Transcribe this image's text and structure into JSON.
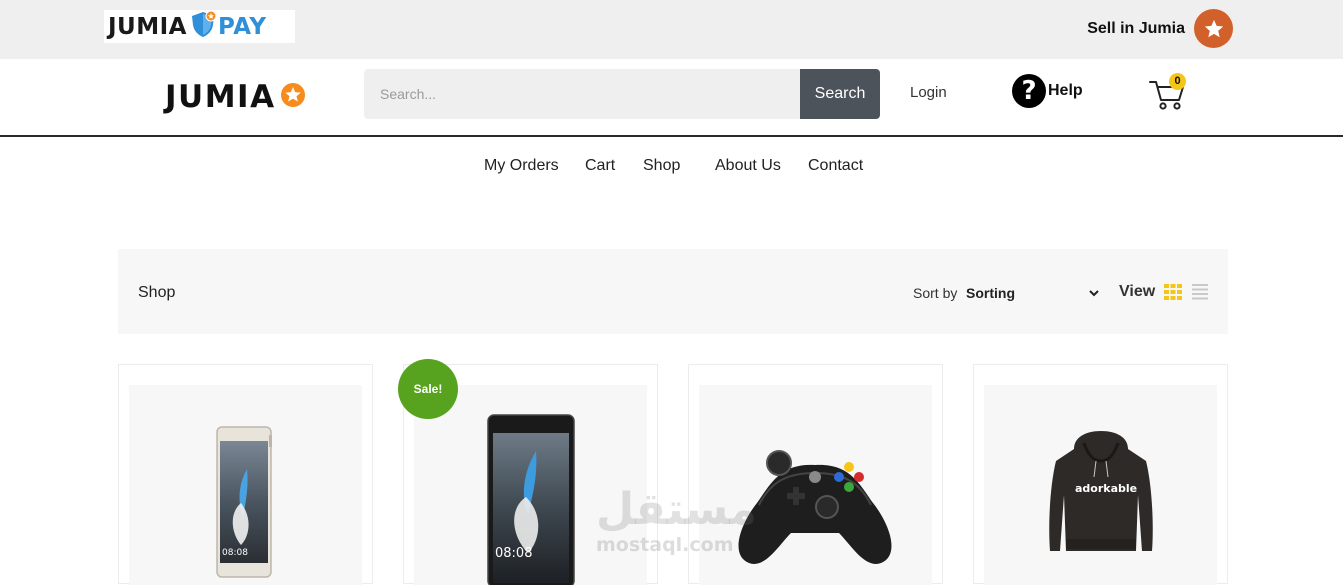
{
  "topbar": {
    "pay_logo_left": "JUMIA",
    "pay_logo_right": "PAY",
    "sell_label": "Sell in Jumia"
  },
  "header": {
    "logo_text": "JUMIA",
    "search_placeholder": "Search...",
    "search_button": "Search",
    "login_label": "Login",
    "help_label": "Help",
    "cart_count": "0"
  },
  "nav": {
    "items": [
      {
        "label": "My Orders"
      },
      {
        "label": "Cart"
      },
      {
        "label": "Shop"
      },
      {
        "label": "About Us"
      },
      {
        "label": "Contact"
      }
    ]
  },
  "shopbar": {
    "title": "Shop",
    "sort_label": "Sort by",
    "sort_value": "Sorting",
    "view_label": "View"
  },
  "products": [
    {
      "image": "smartphone-white"
    },
    {
      "image": "smartphone-black",
      "badge": "Sale!"
    },
    {
      "image": "game-controller"
    },
    {
      "image": "hoodie",
      "print": "adorkable"
    }
  ],
  "watermark": {
    "arabic": "مستقل",
    "latin": "mostaql.com"
  },
  "colors": {
    "accent_orange": "#F68B1E",
    "sell_star": "#D2602A",
    "search_button": "#4D535A",
    "sale_badge": "#57A31F",
    "grid_view_active": "#F5C518",
    "pay_blue": "#2F8FD8"
  }
}
